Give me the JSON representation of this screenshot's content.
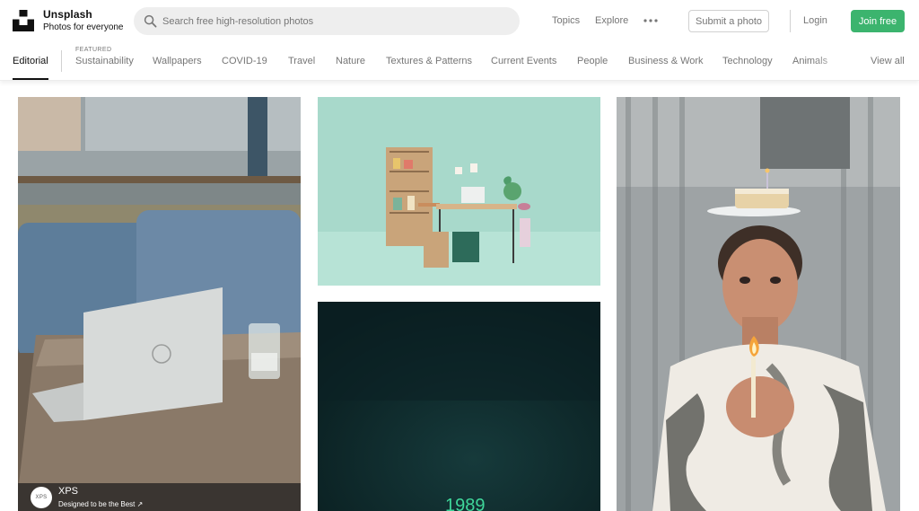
{
  "brand": {
    "name": "Unsplash",
    "tagline": "Photos for everyone"
  },
  "search": {
    "placeholder": "Search free high-resolution photos",
    "value": ""
  },
  "header_nav": {
    "topics": "Topics",
    "explore": "Explore",
    "more_icon": "ellipsis-icon",
    "submit": "Submit a photo",
    "login": "Login",
    "join": "Join free"
  },
  "topics": {
    "active": "Editorial",
    "featured_label": "FEATURED",
    "items": [
      "Sustainability",
      "Wallpapers",
      "COVID-19",
      "Travel",
      "Nature",
      "Textures & Patterns",
      "Current Events",
      "People",
      "Business & Work",
      "Technology",
      "Animals"
    ],
    "view_all": "View all"
  },
  "photos": [
    {
      "subject": "laptop-on-cafe-table",
      "attribution": {
        "avatar_text": "XPS",
        "name": "XPS",
        "subtitle": "Designed to be the Best ↗"
      }
    },
    {
      "subject": "miniature-desk-scene"
    },
    {
      "subject": "dark-night-sign",
      "visible_text": "1989"
    },
    {
      "subject": "person-with-cake-and-candle"
    }
  ],
  "colors": {
    "join_button": "#3cb46e",
    "text_primary": "#111111",
    "text_secondary": "#767676",
    "search_bg": "#eeeeee",
    "mint_photo": "#a8d9cb",
    "sign_green": "#3fd69a"
  }
}
